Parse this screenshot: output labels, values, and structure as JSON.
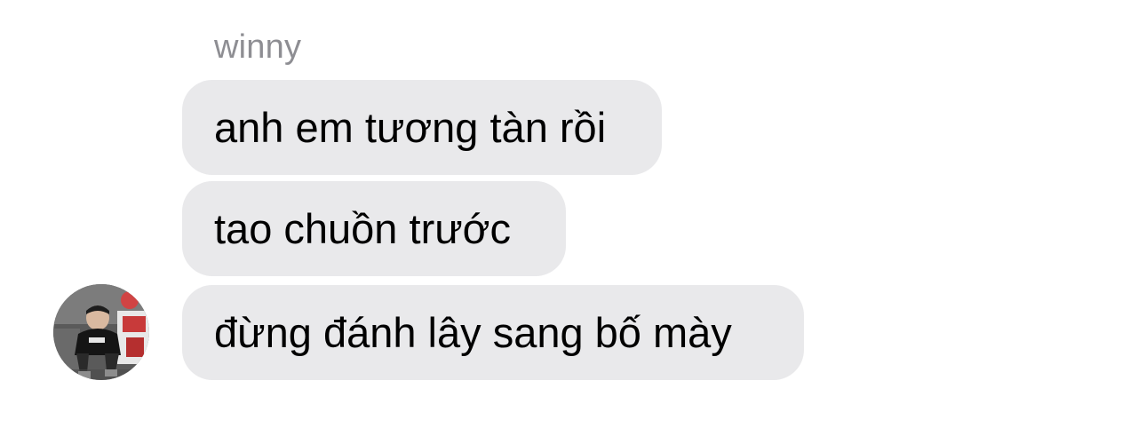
{
  "chat": {
    "sender_name": "winny",
    "messages": [
      {
        "text": "anh em tương tàn rồi"
      },
      {
        "text": "tao chuồn trước"
      },
      {
        "text": "đừng đánh lây sang bố mày"
      }
    ],
    "avatar": {
      "icon": "user-photo-avatar"
    }
  },
  "colors": {
    "bubble_background": "#e9e9eb",
    "sender_name": "#8e8e93",
    "message_text": "#000000"
  }
}
